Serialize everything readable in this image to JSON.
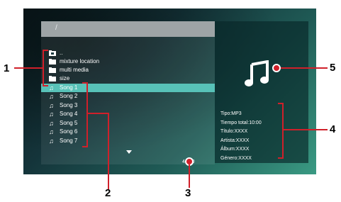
{
  "path": "/",
  "list_items": [
    {
      "label": "..",
      "icon": "parent-folder-icon",
      "selected": false
    },
    {
      "label": "mixture location",
      "icon": "folder-icon",
      "selected": false
    },
    {
      "label": "multi media",
      "icon": "folder-icon",
      "selected": false
    },
    {
      "label": "size",
      "icon": "folder-icon",
      "selected": false
    },
    {
      "label": "Song 1",
      "icon": "music-note-icon",
      "selected": true
    },
    {
      "label": "Song 2",
      "icon": "music-note-icon",
      "selected": false
    },
    {
      "label": "Song 3",
      "icon": "music-note-icon",
      "selected": false
    },
    {
      "label": "Song 4",
      "icon": "music-note-icon",
      "selected": false
    },
    {
      "label": "Song 5",
      "icon": "music-note-icon",
      "selected": false
    },
    {
      "label": "Song 6",
      "icon": "music-note-icon",
      "selected": false
    },
    {
      "label": "Song 7",
      "icon": "music-note-icon",
      "selected": false
    }
  ],
  "page_counter": "4 / 20",
  "info": {
    "tipo": "Tipo:MP3",
    "tiempo": "Tiempo total:10:00",
    "titulo": "Título:XXXX",
    "artista": "Artista:XXXX",
    "album": "Álbum:XXXX",
    "genero": "Género:XXXX"
  },
  "callouts": [
    "1",
    "2",
    "3",
    "4",
    "5"
  ],
  "colors": {
    "selected_row": "#58c2b8",
    "callout": "#d0202a"
  }
}
